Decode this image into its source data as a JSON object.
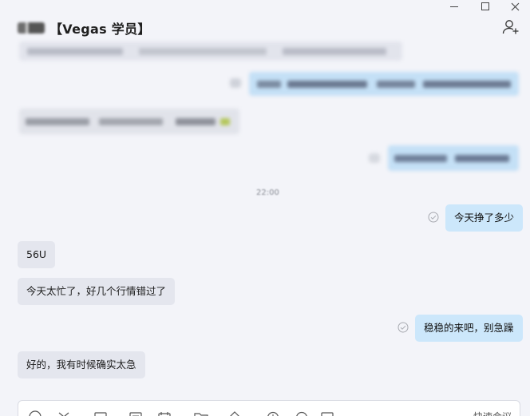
{
  "window": {
    "controls": [
      "minimize-icon",
      "maximize-icon",
      "close-icon"
    ]
  },
  "header": {
    "title": "【Vegas 学员】",
    "add_member_icon": "add-person-icon"
  },
  "chat": {
    "timestamp": "22:00",
    "messages": [
      {
        "direction": "out",
        "text": "今天挣了多少",
        "status": "read"
      },
      {
        "direction": "in",
        "text": "56U"
      },
      {
        "direction": "in",
        "text": "今天太忙了，好几个行情错过了"
      },
      {
        "direction": "out",
        "text": "稳稳的来吧，别急躁",
        "status": "read"
      },
      {
        "direction": "in",
        "text": "好的，我有时候确实太急"
      }
    ]
  },
  "composer": {
    "tools": [
      "emoji-icon",
      "scissors-icon",
      "file-icon",
      "image-icon",
      "calendar-icon",
      "folder-icon",
      "pin-icon",
      "history-icon",
      "chat-record-icon",
      "more-icon"
    ],
    "shortcut_label": "快速会议"
  },
  "colors": {
    "background": "#f3f4f9",
    "incoming_bubble": "#e4e6ee",
    "outgoing_bubble": "#cce7fb"
  }
}
